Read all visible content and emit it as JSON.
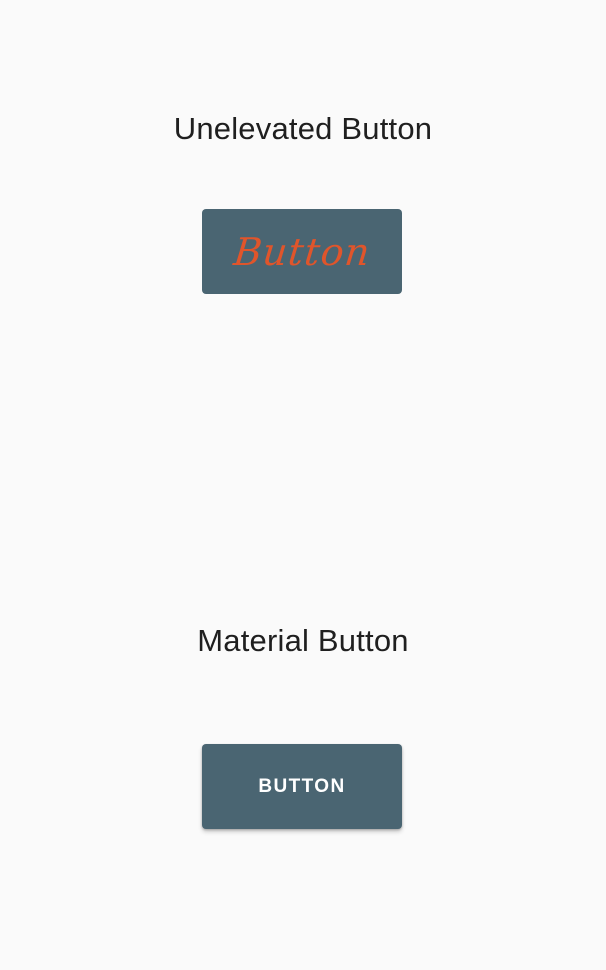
{
  "sections": {
    "unelevated": {
      "title": "Unelevated Button",
      "button_label": "Button",
      "button_bg": "#4a6572",
      "button_text_color": "#e0552b"
    },
    "material": {
      "title": "Material Button",
      "button_label": "BUTTON",
      "button_bg": "#4a6572",
      "button_text_color": "#ffffff"
    }
  },
  "colors": {
    "background": "#fafafa",
    "title_text": "#1f1f1f"
  }
}
